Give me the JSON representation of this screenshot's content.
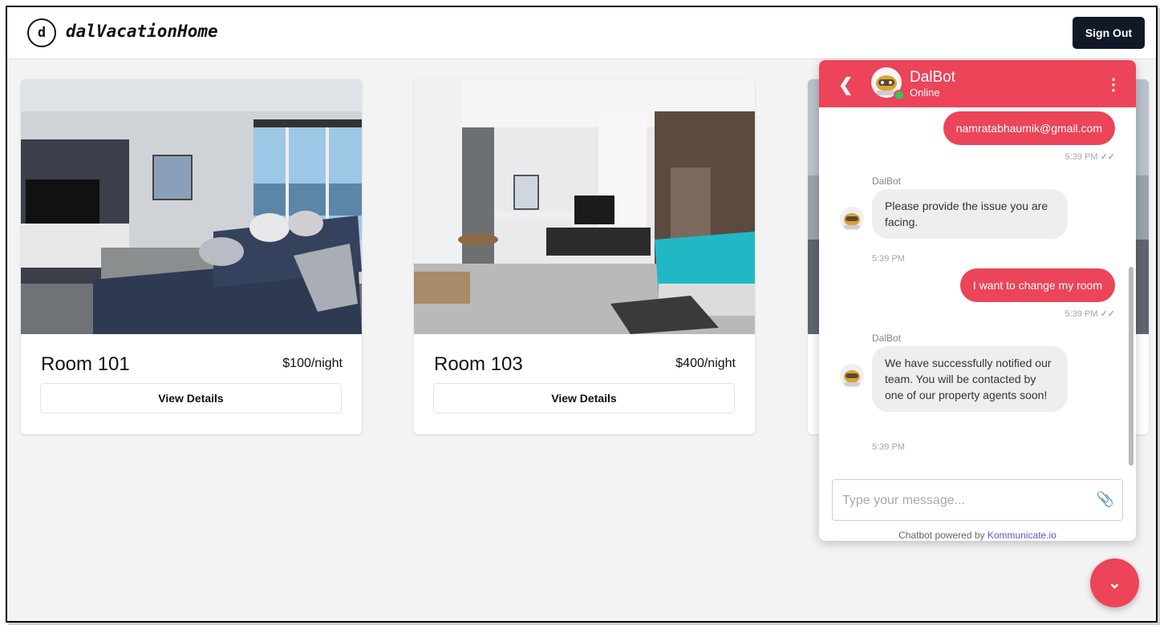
{
  "header": {
    "logo_letter": "d",
    "brand": "dalVacationHome",
    "signout_label": "Sign Out"
  },
  "rooms": [
    {
      "title": "Room 101",
      "price": "$100/night",
      "button": "View Details"
    },
    {
      "title": "Room 103",
      "price": "$400/night",
      "button": "View Details"
    }
  ],
  "chat": {
    "bot_name": "DalBot",
    "status": "Online",
    "messages": [
      {
        "from": "user",
        "text": "namratabhaumik@gmail.com",
        "time": "5:39 PM"
      },
      {
        "from": "bot",
        "sender": "DalBot",
        "text": "Please provide the issue you are facing.",
        "time": "5:39 PM"
      },
      {
        "from": "user",
        "text": "I want to change my room",
        "time": "5:39 PM"
      },
      {
        "from": "bot",
        "sender": "DalBot",
        "text": "We have successfully notified our team. You will be contacted by one of our property agents soon!",
        "time": "5:39 PM"
      }
    ],
    "input_placeholder": "Type your message...",
    "powered_prefix": "Chatbot powered by",
    "powered_link": "Kommunicate.io"
  },
  "colors": {
    "accent": "#ec4458",
    "dark": "#111827",
    "read_ticks": "#4a90e2",
    "link": "#6f4fd3"
  },
  "icons": {
    "back": "chevron-left-icon",
    "menu": "more-vertical-icon",
    "attach": "paperclip-icon",
    "fab": "chevron-down-icon",
    "read_receipt": "double-check-icon"
  }
}
